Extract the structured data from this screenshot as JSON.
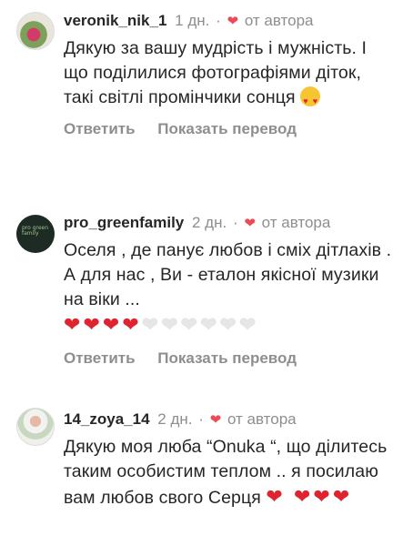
{
  "comments": [
    {
      "username": "veronik_nik_1",
      "time": "1 дн.",
      "dot": "·",
      "author_label": "от автора",
      "text": "Дякую за вашу мудрість і мужність. І що поділилися фотографіями діток, такі світлі промінчики сонця",
      "reply": "Ответить",
      "translate": "Показать перевод"
    },
    {
      "username": "pro_greenfamily",
      "avatar_text": "pro green family",
      "time": "2 дн.",
      "dot": "·",
      "author_label": "от автора",
      "text": "Оселя , де панує любов і сміх дітлахів . А для нас , Ви - еталон якісної музики на віки ...",
      "reply": "Ответить",
      "translate": "Показать перевод"
    },
    {
      "username": "14_zoya_14",
      "time": "2 дн.",
      "dot": "·",
      "author_label": "от автора",
      "text": "Дякую моя люба “Onuka “, що ділитесь таким особистим теплом .. я посилаю вам любов свого Серця"
    }
  ],
  "icons": {
    "author_heart": "heart-filled-red",
    "emoji_face": "smiling-face-heart-eyes",
    "red_heart": "red-heart",
    "white_heart": "white-heart"
  },
  "colors": {
    "accent_red": "#ed4956",
    "muted": "#8e8e8e",
    "text": "#262626"
  }
}
